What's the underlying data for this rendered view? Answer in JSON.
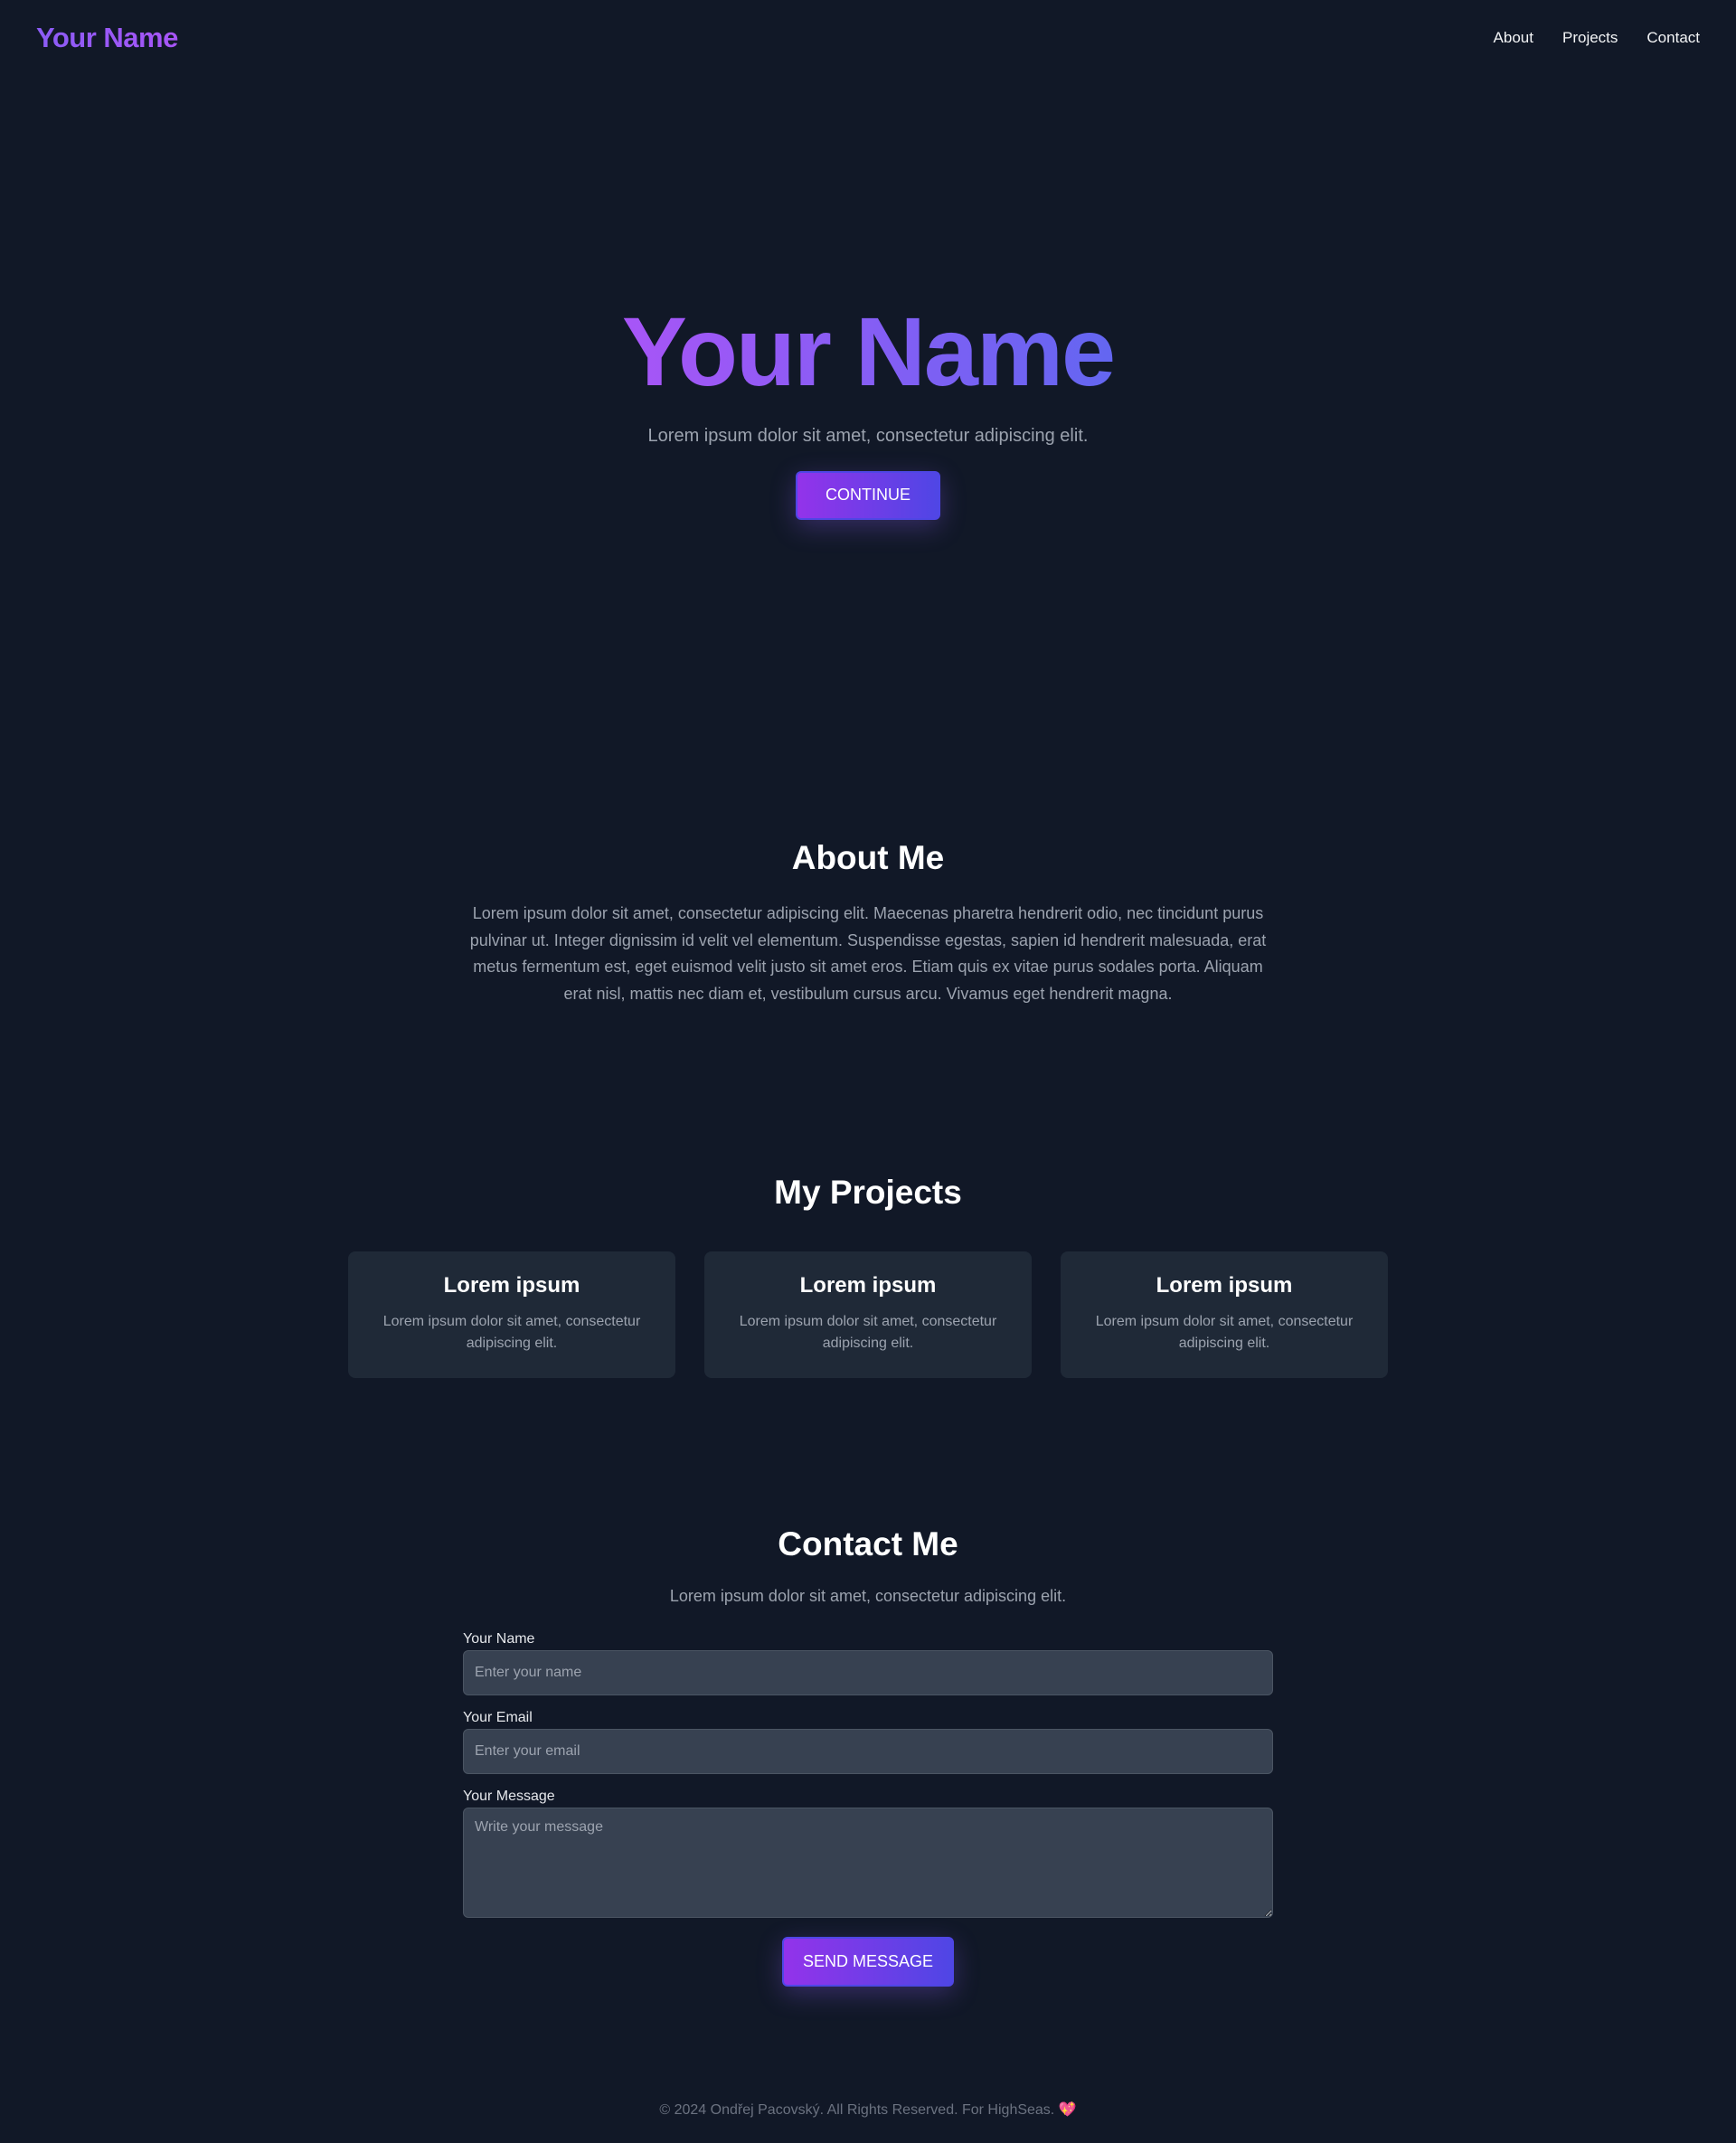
{
  "nav": {
    "brand": "Your Name",
    "links": [
      "About",
      "Projects",
      "Contact"
    ]
  },
  "hero": {
    "title": "Your Name",
    "subtitle": "Lorem ipsum dolor sit amet, consectetur adipiscing elit.",
    "button_label": "CONTINUE"
  },
  "about": {
    "title": "About Me",
    "text": "Lorem ipsum dolor sit amet, consectetur adipiscing elit. Maecenas pharetra hendrerit odio, nec tincidunt purus pulvinar ut. Integer dignissim id velit vel elementum. Suspendisse egestas, sapien id hendrerit malesuada, erat metus fermentum est, eget euismod velit justo sit amet eros. Etiam quis ex vitae purus sodales porta. Aliquam erat nisl, mattis nec diam et, vestibulum cursus arcu. Vivamus eget hendrerit magna."
  },
  "projects": {
    "title": "My Projects",
    "items": [
      {
        "title": "Lorem ipsum",
        "description": "Lorem ipsum dolor sit amet, consectetur adipiscing elit."
      },
      {
        "title": "Lorem ipsum",
        "description": "Lorem ipsum dolor sit amet, consectetur adipiscing elit."
      },
      {
        "title": "Lorem ipsum",
        "description": "Lorem ipsum dolor sit amet, consectetur adipiscing elit."
      }
    ]
  },
  "contact": {
    "title": "Contact Me",
    "subtitle": "Lorem ipsum dolor sit amet, consectetur adipiscing elit.",
    "name_label": "Your Name",
    "name_placeholder": "Enter your name",
    "email_label": "Your Email",
    "email_placeholder": "Enter your email",
    "message_label": "Your Message",
    "message_placeholder": "Write your message",
    "submit_label": "SEND MESSAGE"
  },
  "footer": {
    "text": "© 2024 Ondřej Pacovský. All Rights Reserved. For HighSeas.",
    "heart": "💖"
  },
  "colors": {
    "background": "#111827",
    "card": "#1f2937",
    "input": "#374151",
    "accent_start": "#a855f7",
    "accent_end": "#6366f1",
    "muted_text": "#9ca3af"
  }
}
